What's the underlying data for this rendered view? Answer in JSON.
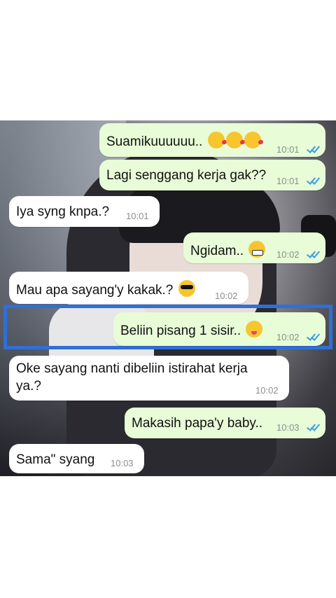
{
  "messages": [
    {
      "text": "Suamikuuuuuu..",
      "emoji": [
        "kiss-emoji",
        "kiss-emoji",
        "kiss-emoji"
      ],
      "time": "10:01",
      "direction": "outgoing",
      "read": true
    },
    {
      "text": "Lagi senggang kerja gak??",
      "time": "10:01",
      "direction": "outgoing",
      "read": true
    },
    {
      "text": "Iya syng knpa.?",
      "time": "10:01",
      "direction": "incoming"
    },
    {
      "text": "Ngidam..",
      "emoji": [
        "grin-emoji"
      ],
      "time": "10:02",
      "direction": "outgoing",
      "read": true
    },
    {
      "text": "Mau apa sayang'y kakak.?",
      "emoji": [
        "sunglasses-emoji"
      ],
      "time": "10:02",
      "direction": "incoming"
    },
    {
      "text": "Beliin pisang 1 sisir..",
      "emoji": [
        "yum-emoji"
      ],
      "time": "10:02",
      "direction": "outgoing",
      "read": true,
      "highlighted": true
    },
    {
      "text": "Oke sayang nanti dibeliin istirahat kerja ya.?",
      "time": "10:02",
      "direction": "incoming"
    },
    {
      "text": "Makasih papa'y baby..",
      "time": "10:03",
      "direction": "outgoing",
      "read": true
    },
    {
      "text": "Sama\" syang",
      "time": "10:03",
      "direction": "incoming"
    }
  ],
  "colors": {
    "outgoing_bubble": "#e7fcd7",
    "incoming_bubble": "#ffffff",
    "read_ticks": "#3b9de2",
    "highlight_border": "#2f6fd8"
  }
}
